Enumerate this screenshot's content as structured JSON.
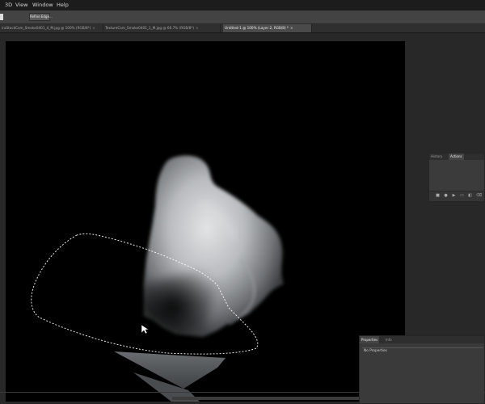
{
  "menu": {
    "items": [
      "3D",
      "View",
      "Window",
      "Help"
    ]
  },
  "options_bar": {
    "refine_edge_label": "Refine Edge..."
  },
  "tabs": [
    {
      "label": "iraStockCom_Smoke0401_4_M.jpg @ 100% (RGB/8*)",
      "close": "×",
      "active": false
    },
    {
      "label": "TextureCom_Smoke0401_1_M.jpg @ 66.7% (RGB/8*)",
      "close": "×",
      "active": false
    },
    {
      "label": "Untitled-1 @ 100% (Layer 2, RGB/8) *",
      "close": "×",
      "active": true
    }
  ],
  "history_panel": {
    "tabs": [
      "History",
      "Actions"
    ],
    "active_tab": "Actions",
    "footer_icons": [
      "stop-icon",
      "record-icon",
      "play-icon",
      "new-set-icon",
      "new-action-icon",
      "delete-icon"
    ]
  },
  "properties_panel": {
    "tabs": [
      "Properties",
      "Info"
    ],
    "active_tab": "Properties",
    "heading": "No Properties"
  },
  "colors": {
    "app_bg": "#2b2b2b",
    "canvas_bg": "#000000",
    "menubar_bg": "#1c1c1c",
    "panel_bg": "#3b3b3b",
    "smoke_light": "#d8dadb",
    "smoke_mid": "#8a8d90",
    "marquee": "#ffffff"
  }
}
